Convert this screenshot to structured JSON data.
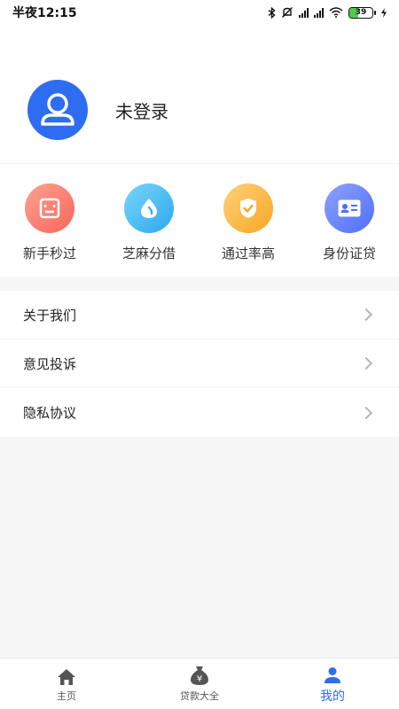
{
  "status_bar": {
    "time": "半夜12:15",
    "battery_level": "39",
    "battery_fraction": 0.39,
    "icons": [
      "bluetooth-icon",
      "mute-icon",
      "hd-signal-icon",
      "hd-signal-icon",
      "wifi-icon",
      "battery-icon",
      "charging-icon"
    ]
  },
  "profile": {
    "login_status": "未登录",
    "avatar_color": "#2e6df2"
  },
  "features": [
    {
      "label": "新手秒过",
      "icon": "form-icon",
      "color_start": "#ffa392",
      "color_end": "#f6655a"
    },
    {
      "label": "芝麻分借",
      "icon": "drop-icon",
      "color_start": "#7ad6fb",
      "color_end": "#2aa8ec"
    },
    {
      "label": "通过率高",
      "icon": "shield-check-icon",
      "color_start": "#ffd27a",
      "color_end": "#f6a623"
    },
    {
      "label": "身份证贷",
      "icon": "id-card-icon",
      "color_start": "#8ea2ff",
      "color_end": "#4f6ef7"
    }
  ],
  "menu": [
    {
      "label": "关于我们"
    },
    {
      "label": "意见投诉"
    },
    {
      "label": "隐私协议"
    }
  ],
  "tabbar": {
    "accent": "#2e6df2",
    "tabs": [
      {
        "label": "主页",
        "icon": "home-icon"
      },
      {
        "label": "贷款大全",
        "icon": "money-bag-icon"
      },
      {
        "label": "我的",
        "icon": "user-icon"
      }
    ]
  }
}
